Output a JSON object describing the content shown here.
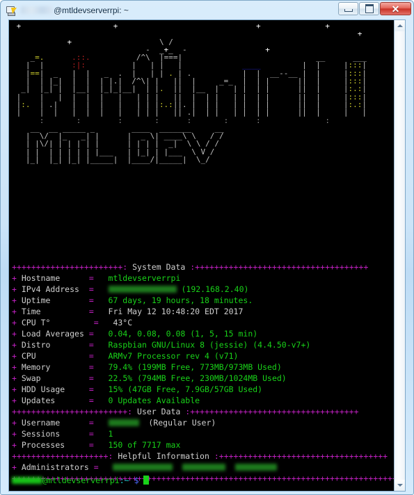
{
  "window": {
    "title_user_redacted": true,
    "title_suffix": "@mtldevserverrpi: ~",
    "icon": "putty-icon",
    "buttons": {
      "minimize": "–",
      "maximize": "❐",
      "close": "✕"
    }
  },
  "terminal": {
    "background": "#000000",
    "ascii_art": {
      "skyline_color": "#bfbfbf",
      "accent_yellow": "#cfcf2e",
      "accent_red": "#b81f1f",
      "accent_blue": "#2222cc",
      "skyline": [
        " +                    +                              +              +",
        "                                                                           +",
        "            +                   \\ /",
        "                             -  _+_  -                 +",
        "    _=.      .::.          /^\\  |===|                             __      ___",
        "   |  |      :|:          |   | |   |             ____         |  |     |:::|",
        "   |==|  _   |  |   _  .  |   | | . | .           |  |  __--__ |  |     |:::|",
        "   |  | |_|  |  |  | |.|  /^\\| |   ||  |     _=_  |  | |      ||  |     |:::|",
        "  _|  |_| |  |__|  |_|_|__|  | |.  ||  |__  |   | |  | |      ||  |     |:.:|",
        " |    |   |  |  |  |   |   | | |   ||  |  | |   | |  | |      ||  |     |:::|",
        " |:.  | .|   |  |  |   |   | | |:.:||. |  | |   | |  | |      ||  |     |:.:|",
        " |    |  |   |  |  |   |   | | |   || .|  | |   | |  | |      ||  |     |   |",
        "      :       :        :       :      :       :      :              :"
      ],
      "logo": [
        "    __  __ _____ _        ____  _______     __",
        "   |  \\/  |_   _| |      |  _ \\| ____\\ \\   / /",
        "   | |\\/| | | | | |      | | | |  _|  \\ \\ / / ",
        "   | |  | | | | | |___   | |_| | |___  \\ V /  ",
        "   |_|  |_| |_| |_____|  |____/|_____|  \\_/   "
      ],
      "logo_color": "#15b915"
    },
    "sections": [
      {
        "title": "System Data",
        "separator_char": "+",
        "separator_color": "#c020c0",
        "rows": [
          {
            "label": "Hostname",
            "value": "mtldevserverrpi",
            "redacted": false
          },
          {
            "label": "IPv4 Address",
            "value": "(192.168.2.40)",
            "redacted": true
          },
          {
            "label": "Uptime",
            "value": "67 days, 19 hours, 18 minutes.",
            "redacted": false
          },
          {
            "label": "Time",
            "value": "Fri May 12 10:48:20 EDT 2017",
            "redacted": false
          },
          {
            "label": "CPU T°",
            "value": "43°C",
            "redacted": false
          },
          {
            "label": "Load Averages",
            "value": "0.04, 0.08, 0.08 (1, 5, 15 min)",
            "redacted": false
          },
          {
            "label": "Distro",
            "value": "Raspbian GNU/Linux 8 (jessie) (4.4.50-v7+)",
            "redacted": false
          },
          {
            "label": "CPU",
            "value": "ARMv7 Processor rev 4 (v71)",
            "redacted": false
          },
          {
            "label": "Memory",
            "value": "79.4% (199MB Free, 773MB/973MB Used)",
            "redacted": false
          },
          {
            "label": "Swap",
            "value": "22.5% (794MB Free, 230MB/1024MB Used)",
            "redacted": false
          },
          {
            "label": "HDD Usage",
            "value": "15% (47GB Free, 7.9GB/57GB Used)",
            "redacted": false
          },
          {
            "label": "Updates",
            "value": "0 Updates Available",
            "redacted": false
          }
        ]
      },
      {
        "title": "User Data",
        "rows": [
          {
            "label": "Username",
            "value": "(Regular User)",
            "redacted": true
          },
          {
            "label": "Sessions",
            "value": "1",
            "redacted": false
          },
          {
            "label": "Processes",
            "value": "150 of 7717 max",
            "redacted": false
          }
        ]
      },
      {
        "title": "Helpful Information",
        "rows": [
          {
            "label": "Administrators",
            "value": "",
            "redacted": true
          }
        ]
      }
    ],
    "prompt": {
      "user_redacted": true,
      "host": "@mtldevserverrpi",
      "path": ":~",
      "symbol": "$",
      "cursor": "block",
      "user_color": "#19d219",
      "path_color": "#19d2d2",
      "symbol_color": "#4d6cff"
    }
  },
  "scrollbar": {
    "up_arrow": "▲",
    "down_arrow": "▼"
  }
}
